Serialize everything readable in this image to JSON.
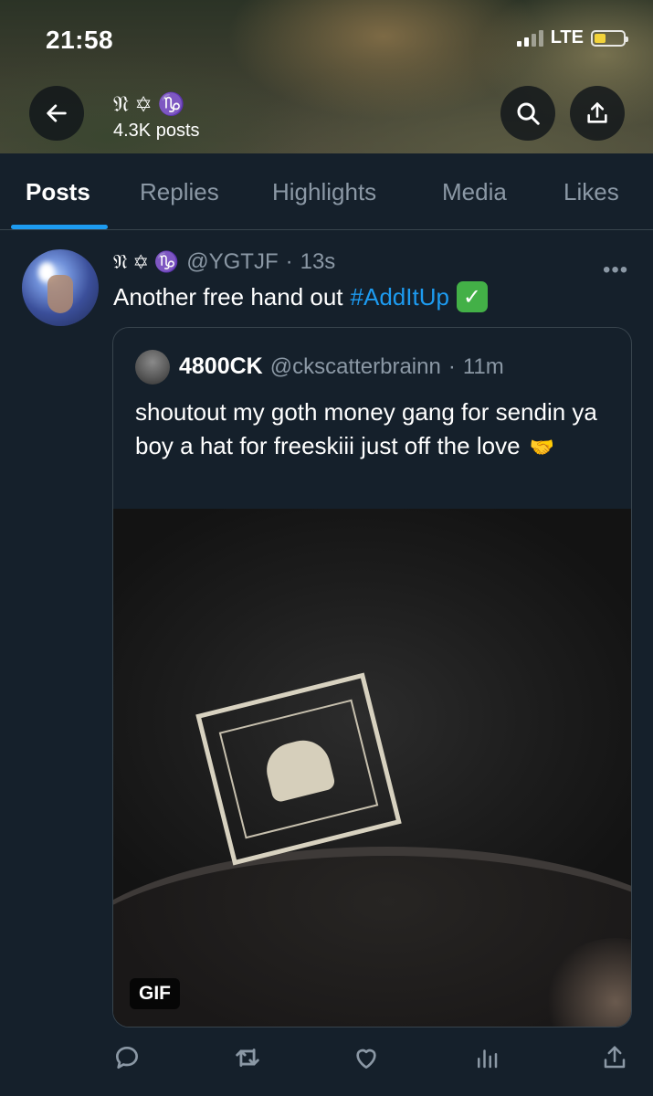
{
  "status_bar": {
    "time": "21:58",
    "network": "LTE"
  },
  "header": {
    "display_name_symbols": "𝔑 ✡ ♑",
    "posts_count": "4.3K posts"
  },
  "tabs": [
    {
      "label": "Posts",
      "active": true
    },
    {
      "label": "Replies",
      "active": false
    },
    {
      "label": "Highlights",
      "active": false
    },
    {
      "label": "Media",
      "active": false
    },
    {
      "label": "Likes",
      "active": false
    }
  ],
  "tweet": {
    "display_name": "𝔑 ✡ ♑",
    "handle": "@YGTJF",
    "separator": "·",
    "time": "13s",
    "text": "Another free hand out",
    "hashtag": "#AddItUp",
    "check_glyph": "✓",
    "more_glyph": "•••",
    "quote": {
      "name": "4800CK",
      "handle": "@ckscatterbrainn",
      "separator": "·",
      "time": "11m",
      "text": "shoutout my goth money gang for sendin ya boy a hat for freeskiii just off the love",
      "emoji": "🤝",
      "media_badge": "GIF"
    }
  },
  "actions": [
    "reply-icon",
    "retweet-icon",
    "like-icon",
    "views-icon",
    "share-icon"
  ],
  "colors": {
    "background": "#15202b",
    "accent": "#1d9bf0",
    "muted_text": "#8b98a5",
    "border": "#38444d",
    "check_green": "#43b047"
  }
}
